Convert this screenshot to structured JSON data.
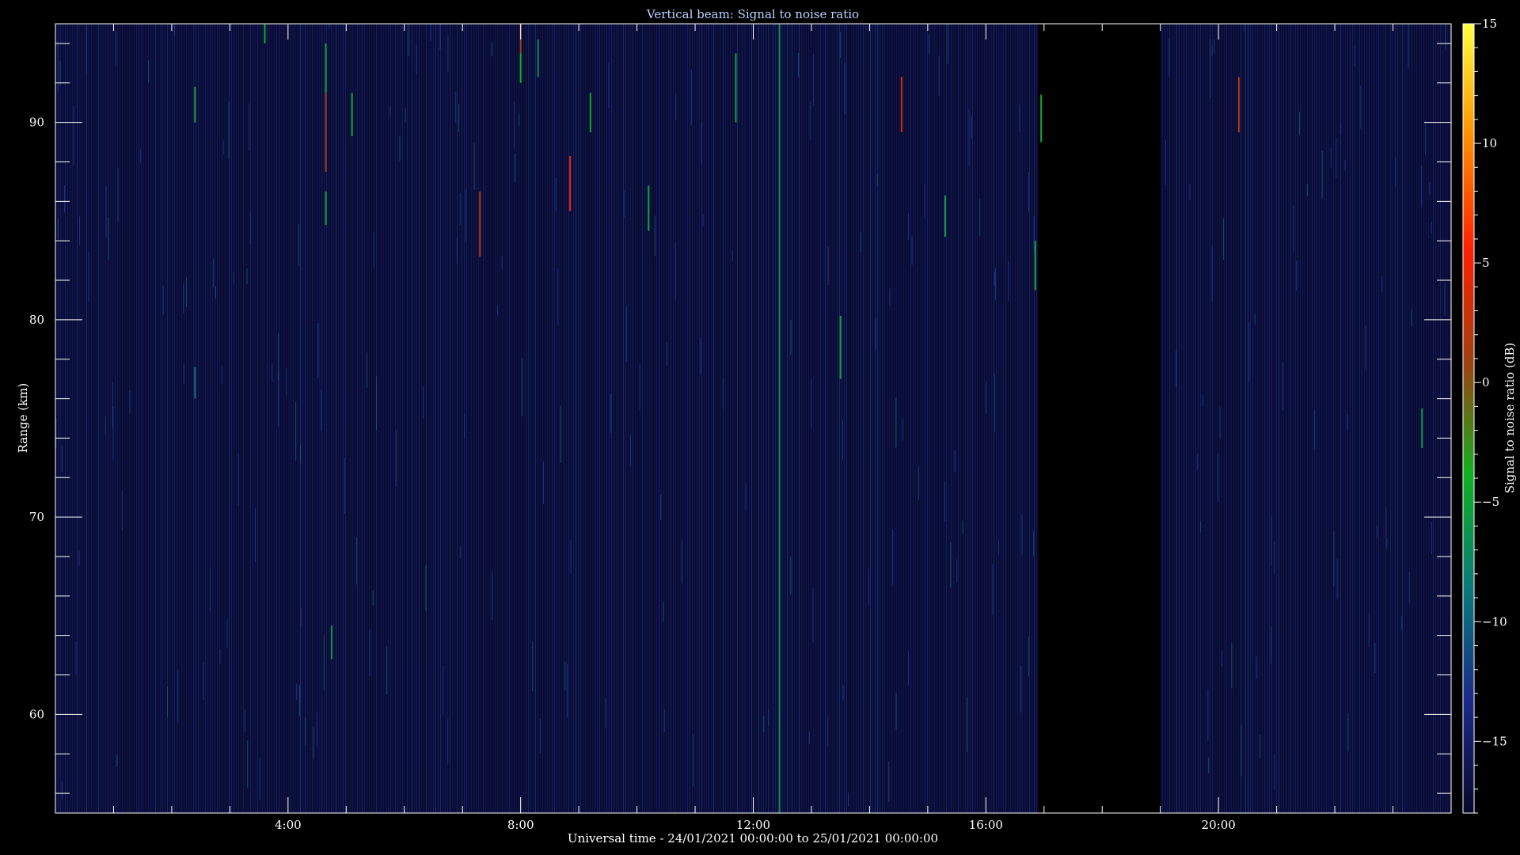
{
  "chart_data": {
    "type": "heatmap",
    "title": "Vertical beam: Signal to noise ratio",
    "xlabel": "Universal time - 24/01/2021 00:00:00 to 25/01/2021 00:00:00",
    "ylabel": "Range (km)",
    "colorbar_label": "Signal to noise ratio (dB)",
    "xlim_hours": [
      0,
      24
    ],
    "ylim_km": [
      55,
      95
    ],
    "clim_db": [
      -18,
      15
    ],
    "x_ticks": [
      {
        "hour": 4,
        "label": "4:00"
      },
      {
        "hour": 8,
        "label": "8:00"
      },
      {
        "hour": 12,
        "label": "12:00"
      },
      {
        "hour": 16,
        "label": "16:00"
      },
      {
        "hour": 20,
        "label": "20:00"
      }
    ],
    "y_ticks": [
      {
        "km": 60,
        "label": "60"
      },
      {
        "km": 70,
        "label": "70"
      },
      {
        "km": 80,
        "label": "80"
      },
      {
        "km": 90,
        "label": "90"
      }
    ],
    "colorbar_ticks": [
      {
        "db": 15,
        "label": "15"
      },
      {
        "db": 10,
        "label": "10"
      },
      {
        "db": 5,
        "label": "5"
      },
      {
        "db": 0,
        "label": "0"
      },
      {
        "db": -5,
        "label": "−5"
      },
      {
        "db": -10,
        "label": "−10"
      },
      {
        "db": -15,
        "label": "−15"
      }
    ],
    "colorscale": [
      "#08082a",
      "#1a2a8a",
      "#0a7a7a",
      "#10b020",
      "#a04010",
      "#ff2000",
      "#ff9000",
      "#ffff40"
    ],
    "background_color": "#0a0d33",
    "no_data_interval_hours": [
      16.9,
      19.0
    ],
    "echoes": [
      {
        "hour": 2.4,
        "km_from": 90.0,
        "km_to": 91.8,
        "db": -5
      },
      {
        "hour": 2.4,
        "km_from": 76.0,
        "km_to": 77.6,
        "db": -9
      },
      {
        "hour": 3.6,
        "km_from": 94.0,
        "km_to": 95.0,
        "db": -4
      },
      {
        "hour": 4.65,
        "km_from": 87.5,
        "km_to": 91.5,
        "db": 1
      },
      {
        "hour": 4.65,
        "km_from": 91.5,
        "km_to": 94.0,
        "db": -5
      },
      {
        "hour": 4.65,
        "km_from": 84.8,
        "km_to": 86.5,
        "db": -5
      },
      {
        "hour": 4.75,
        "km_from": 62.8,
        "km_to": 64.5,
        "db": -6
      },
      {
        "hour": 5.1,
        "km_from": 89.3,
        "km_to": 91.5,
        "db": -5
      },
      {
        "hour": 7.3,
        "km_from": 83.2,
        "km_to": 86.5,
        "db": 2
      },
      {
        "hour": 8.0,
        "km_from": 93.5,
        "km_to": 95.0,
        "db": 1
      },
      {
        "hour": 8.0,
        "km_from": 92.0,
        "km_to": 93.5,
        "db": -4
      },
      {
        "hour": 8.3,
        "km_from": 92.3,
        "km_to": 94.2,
        "db": -7
      },
      {
        "hour": 8.85,
        "km_from": 85.5,
        "km_to": 88.3,
        "db": 5
      },
      {
        "hour": 9.2,
        "km_from": 89.5,
        "km_to": 91.5,
        "db": -5
      },
      {
        "hour": 10.2,
        "km_from": 84.5,
        "km_to": 86.8,
        "db": -5
      },
      {
        "hour": 11.7,
        "km_from": 90.0,
        "km_to": 93.5,
        "db": -5
      },
      {
        "hour": 12.45,
        "km_from": 55.0,
        "km_to": 95.0,
        "db": -7
      },
      {
        "hour": 13.5,
        "km_from": 77.0,
        "km_to": 80.2,
        "db": -5
      },
      {
        "hour": 14.55,
        "km_from": 89.5,
        "km_to": 92.3,
        "db": 4
      },
      {
        "hour": 15.3,
        "km_from": 84.2,
        "km_to": 86.3,
        "db": -5
      },
      {
        "hour": 16.85,
        "km_from": 81.5,
        "km_to": 84.0,
        "db": -5
      },
      {
        "hour": 16.95,
        "km_from": 89.0,
        "km_to": 91.4,
        "db": -5
      },
      {
        "hour": 20.35,
        "km_from": 89.5,
        "km_to": 92.3,
        "db": 2
      },
      {
        "hour": 23.5,
        "km_from": 73.5,
        "km_to": 75.5,
        "db": -6
      }
    ]
  }
}
